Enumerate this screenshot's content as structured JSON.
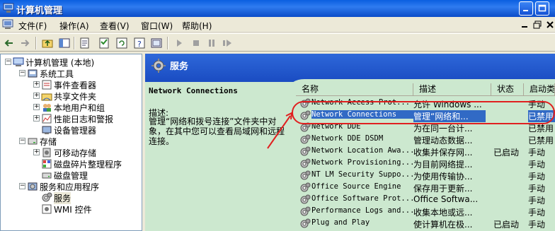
{
  "window": {
    "title": "计算机管理"
  },
  "menu": {
    "items": [
      "文件(F)",
      "操作(A)",
      "查看(V)",
      "窗口(W)",
      "帮助(H)"
    ]
  },
  "tree": {
    "items": [
      {
        "label": "计算机管理 (本地)",
        "level": 0,
        "expander": "-",
        "icon": "computer-icon"
      },
      {
        "label": "系统工具",
        "level": 1,
        "expander": "-",
        "icon": "tools-icon"
      },
      {
        "label": "事件查看器",
        "level": 2,
        "expander": "+",
        "icon": "event-viewer-icon"
      },
      {
        "label": "共享文件夹",
        "level": 2,
        "expander": "+",
        "icon": "shared-folder-icon"
      },
      {
        "label": "本地用户和组",
        "level": 2,
        "expander": "+",
        "icon": "users-icon"
      },
      {
        "label": "性能日志和警报",
        "level": 2,
        "expander": "+",
        "icon": "performance-icon"
      },
      {
        "label": "设备管理器",
        "level": 2,
        "expander": "",
        "icon": "device-manager-icon"
      },
      {
        "label": "存储",
        "level": 1,
        "expander": "-",
        "icon": "storage-icon"
      },
      {
        "label": "可移动存储",
        "level": 2,
        "expander": "+",
        "icon": "removable-storage-icon"
      },
      {
        "label": "磁盘碎片整理程序",
        "level": 2,
        "expander": "",
        "icon": "defrag-icon"
      },
      {
        "label": "磁盘管理",
        "level": 2,
        "expander": "",
        "icon": "disk-icon"
      },
      {
        "label": "服务和应用程序",
        "level": 1,
        "expander": "-",
        "icon": "services-apps-icon"
      },
      {
        "label": "服务",
        "level": 2,
        "expander": "",
        "icon": "services-icon"
      },
      {
        "label": "WMI 控件",
        "level": 2,
        "expander": "",
        "icon": "wmi-icon"
      }
    ]
  },
  "panel": {
    "title": "服务"
  },
  "description": {
    "service_name": "Network Connections",
    "label": "描述:",
    "text": "管理“网络和拨号连接”文件夹中对象，在其中您可以查看局域网和远程连接。"
  },
  "services": {
    "columns": [
      "名称",
      "描述",
      "状态",
      "启动类"
    ],
    "rows": [
      {
        "name": "Network Access Prot...",
        "desc": "允许 Windows ...",
        "status": "",
        "startup": "手动"
      },
      {
        "name": "Network Connections",
        "desc": "管理“网络和...",
        "status": "",
        "startup": "已禁用"
      },
      {
        "name": "Network DDE",
        "desc": "为在同一台计...",
        "status": "",
        "startup": "已禁用"
      },
      {
        "name": "Network DDE DSDM",
        "desc": "管理动态数据...",
        "status": "",
        "startup": "已禁用"
      },
      {
        "name": "Network Location Awa...",
        "desc": "收集并保存网...",
        "status": "已启动",
        "startup": "手动"
      },
      {
        "name": "Network Provisioning...",
        "desc": "为目前网络提...",
        "status": "",
        "startup": "手动"
      },
      {
        "name": "NT LM Security Suppo...",
        "desc": "为使用传输协...",
        "status": "",
        "startup": "手动"
      },
      {
        "name": "Office Source Engine",
        "desc": "保存用于更新...",
        "status": "",
        "startup": "手动"
      },
      {
        "name": "Office Software Prot...",
        "desc": "Office Softwa...",
        "status": "",
        "startup": "手动"
      },
      {
        "name": "Performance Logs and...",
        "desc": "收集本地或远...",
        "status": "",
        "startup": "手动"
      },
      {
        "name": "Plug and Play",
        "desc": "使计算机在极...",
        "status": "已启动",
        "startup": "手动"
      }
    ],
    "selected_index": 1
  },
  "colors": {
    "accent": "#316AC5",
    "panel_bg": "#CCE8CF",
    "header_blue": "#1A4CC2",
    "annotation": "#E02020"
  }
}
